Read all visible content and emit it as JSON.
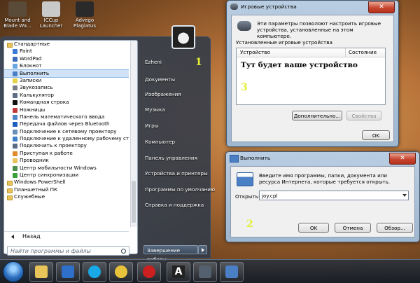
{
  "desktop_icons": [
    {
      "label": "Mount and Blade Wa...",
      "color": "#5a4a38"
    },
    {
      "label": "ICCup Launcher",
      "color": "#c9c9c9"
    },
    {
      "label": "Advego Plagiatus",
      "color": "#2a2a2a"
    }
  ],
  "start_menu": {
    "programs": [
      {
        "label": "Стандартные",
        "type": "folder"
      },
      {
        "label": "Paint",
        "color": "#3b7ad6"
      },
      {
        "label": "WordPad",
        "color": "#3b6bbd"
      },
      {
        "label": "Блокнот",
        "color": "#6aa7e0"
      },
      {
        "label": "Выполнить",
        "color": "#4a7fc6",
        "highlighted": true
      },
      {
        "label": "Записки",
        "color": "#e6d34a"
      },
      {
        "label": "Звукозапись",
        "color": "#7a7f87"
      },
      {
        "label": "Калькулятор",
        "color": "#5d6d82"
      },
      {
        "label": "Командная строка",
        "color": "#111111"
      },
      {
        "label": "Ножницы",
        "color": "#c23b3b"
      },
      {
        "label": "Панель математического ввода",
        "color": "#4f86c6"
      },
      {
        "label": "Передача файлов через Bluetooth",
        "color": "#1d5fbf"
      },
      {
        "label": "Подключение к сетевому проектору",
        "color": "#6a8fb8"
      },
      {
        "label": "Подключение к удаленному рабочему сто",
        "color": "#3f7fc9"
      },
      {
        "label": "Подключить к проектору",
        "color": "#5a6c84"
      },
      {
        "label": "Приступая к работе",
        "color": "#e08a2a"
      },
      {
        "label": "Проводник",
        "color": "#e7c35a"
      },
      {
        "label": "Центр мобильности Windows",
        "color": "#4a8e4a"
      },
      {
        "label": "Центр синхронизации",
        "color": "#3aa03a"
      },
      {
        "label": "Windows PowerShell",
        "type": "folder"
      },
      {
        "label": "Планшетный ПК",
        "type": "folder"
      },
      {
        "label": "Служебные",
        "type": "folder"
      }
    ],
    "back_label": "Назад",
    "search_placeholder": "Найти программы и файлы",
    "right_items": [
      "Ezheni",
      "Документы",
      "Изображения",
      "Музыка",
      "Игры",
      "Компьютер",
      "Панель управления",
      "Устройства и принтеры",
      "Программы по умолчанию",
      "Справка и поддержка"
    ],
    "shutdown_label": "Завершение работы"
  },
  "annotations": {
    "one": "1",
    "two": "2",
    "three": "3",
    "color": "#e4ef37"
  },
  "game_window": {
    "title": "Игровые устройства",
    "close": "✕",
    "description": "Эти параметры позволяют настроить игровые устройства, установленные на этом компьютере.",
    "section_label": "Установленные игровые устройства",
    "col_device": "Устройство",
    "col_status": "Состояние",
    "device_placeholder": "Тут будет ваше устройство",
    "advanced_button": "Дополнительно...",
    "properties_button": "Свойства",
    "ok_button": "OK"
  },
  "run_window": {
    "title": "Выполнить",
    "close": "✕",
    "description": "Введите имя программы, папки, документа или ресурса Интернета, которые требуется открыть.",
    "open_label": "Открыть:",
    "input_value": "joy.cpl",
    "ok_button": "OK",
    "cancel_button": "Отмена",
    "browse_button": "Обзор..."
  },
  "taskbar": {
    "items": [
      {
        "name": "explorer",
        "color": "#e7c35a"
      },
      {
        "name": "media-player",
        "color": "#2d6fc9"
      },
      {
        "name": "skype",
        "color": "#18a9e6"
      },
      {
        "name": "chrome",
        "color": "#e8c23a"
      },
      {
        "name": "opera",
        "color": "#cc1f1f"
      },
      {
        "name": "advego",
        "color": "#222222"
      },
      {
        "name": "game-controllers",
        "color": "#55606e"
      },
      {
        "name": "run",
        "color": "#4a7fc6"
      }
    ],
    "advego_glyph": "A"
  }
}
